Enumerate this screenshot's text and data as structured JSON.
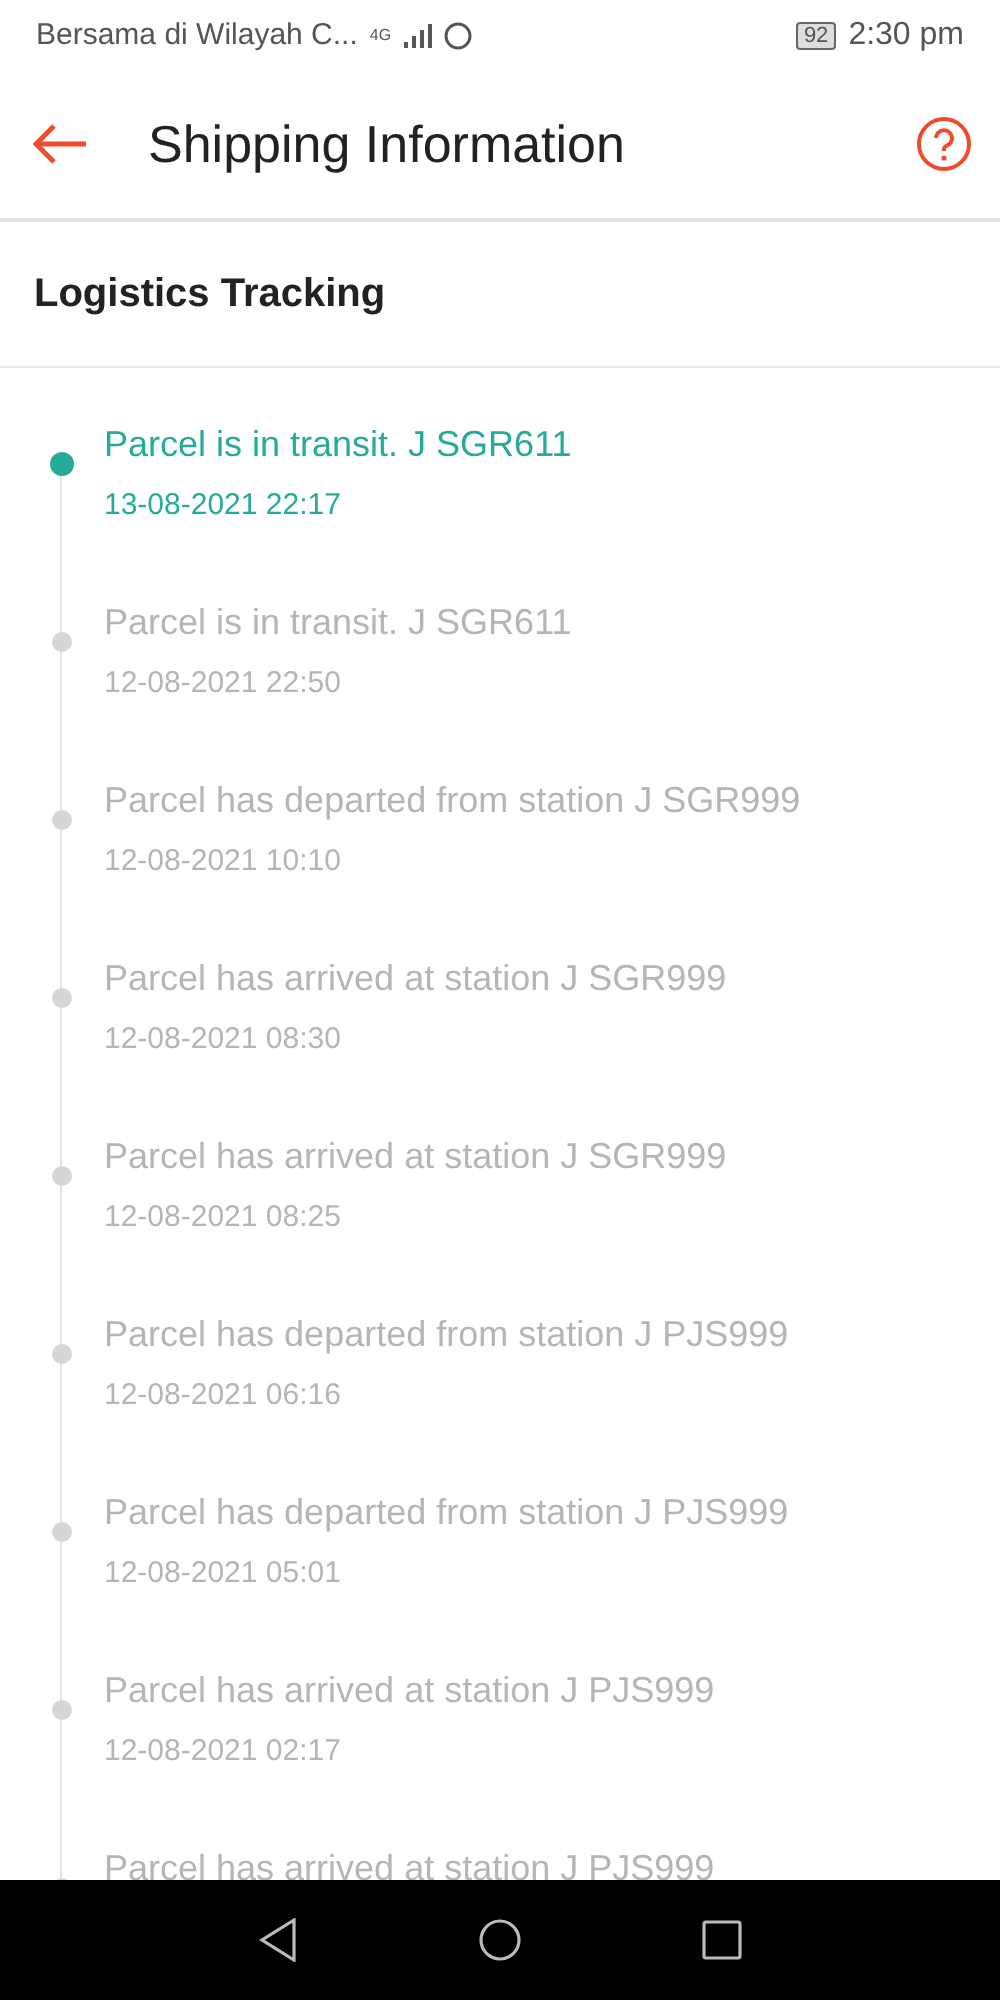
{
  "status_bar": {
    "carrier": "Bersama di Wilayah C...",
    "network": "4G",
    "battery": "92",
    "time": "2:30 pm"
  },
  "header": {
    "title": "Shipping Information"
  },
  "section": {
    "title": "Logistics Tracking"
  },
  "events": [
    {
      "text": "Parcel is in transit. J SGR611",
      "time": "13-08-2021 22:17",
      "selected": true
    },
    {
      "text": "Parcel is in transit. J SGR611",
      "time": "12-08-2021 22:50",
      "selected": false
    },
    {
      "text": "Parcel has departed from station J SGR999",
      "time": "12-08-2021 10:10",
      "selected": false
    },
    {
      "text": "Parcel has arrived at station J SGR999",
      "time": "12-08-2021 08:30",
      "selected": false
    },
    {
      "text": "Parcel has arrived at station J SGR999",
      "time": "12-08-2021 08:25",
      "selected": false
    },
    {
      "text": "Parcel has departed from station J PJS999",
      "time": "12-08-2021 06:16",
      "selected": false
    },
    {
      "text": "Parcel has departed from station J PJS999",
      "time": "12-08-2021 05:01",
      "selected": false
    },
    {
      "text": "Parcel has arrived at station J PJS999",
      "time": "12-08-2021 02:17",
      "selected": false
    },
    {
      "text": "Parcel has arrived at station J PJS999",
      "selected": false
    }
  ]
}
